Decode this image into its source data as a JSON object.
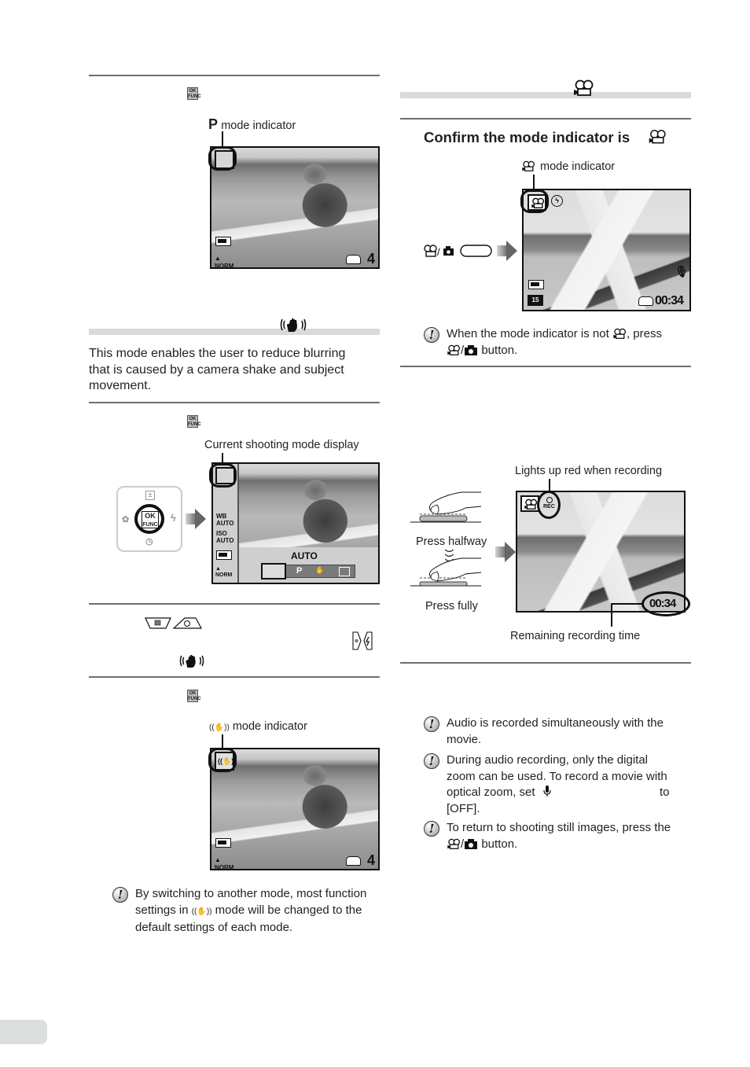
{
  "left_column": {
    "section_p": {
      "step_icon": "ok-func-button-icon",
      "callout_label": "mode indicator",
      "callout_prefix": "P",
      "lcd": {
        "image_subject": "girl reading on grass",
        "bottom_left_icons": [
          "battery-icon",
          "image-quality-norm-icon"
        ],
        "bottom_right_icon": "memory-icon",
        "shots_remaining": "4"
      }
    },
    "section_dis": {
      "header_icon": "digital-image-stabilization-icon",
      "description": [
        "This mode enables the user to reduce blurring",
        "that is caused by a camera shake and subject",
        "movement."
      ],
      "step1": {
        "step_icon": "ok-func-button-icon",
        "callout_label": "Current shooting mode display",
        "dpad": {
          "center_top": "OK",
          "center_bottom": "FUNC",
          "up_icon": "exposure-compensation-icon",
          "down_icon": "self-timer-icon",
          "left_icon": "macro-icon",
          "right_icon": "flash-icon"
        },
        "lcd": {
          "side_items": [
            "WB AUTO",
            "ISO AUTO",
            "battery-icon",
            "NORM"
          ],
          "wb_line1": "WB",
          "wb_line2": "AUTO",
          "iso_line1": "ISO",
          "iso_line2": "AUTO",
          "norm": "NORM",
          "selected_mode_label": "AUTO",
          "mode_options": [
            "AUTO",
            "P",
            "DIS",
            "SCENE"
          ],
          "mode_p": "P"
        }
      },
      "step2": {
        "buttons_icons": [
          "exposure-compensation-button-icon",
          "self-timer-button-icon"
        ],
        "side_buttons_icons": [
          "macro-button-icon",
          "flash-button-icon"
        ],
        "target_icon": "digital-image-stabilization-icon"
      },
      "step3": {
        "step_icon": "ok-func-button-icon",
        "callout_label": "mode indicator",
        "lcd": {
          "shots_remaining": "4"
        }
      },
      "note": {
        "line1": "By switching to another mode, most function",
        "line2a": "settings in",
        "line2b": "mode will be changed to the",
        "line3": "default settings of each mode."
      }
    }
  },
  "right_column": {
    "section_movie": {
      "header_icon": "movie-mode-icon",
      "step1": {
        "heading": "Confirm the mode indicator is",
        "callout_label": "mode indicator",
        "button_label_icons": [
          "movie-icon",
          "camera-icon"
        ],
        "button_sep": "/",
        "lcd": {
          "image_subject": "seagull in flight",
          "top_icons": [
            "movie-mode-icon",
            "flash-off-icon"
          ],
          "right_icon": "microphone-icon",
          "bottom_left_icons": [
            "battery-icon",
            "frame-rate-15-icon"
          ],
          "frame_rate": "15",
          "remaining_time": "00:34"
        },
        "note": {
          "line1a": "When the mode indicator is not",
          "line1b": ", press",
          "line2b": "button.",
          "sep": "/"
        }
      },
      "step2": {
        "callout_top": "Lights up red when recording",
        "press_halfway": "Press halfway",
        "press_fully": "Press fully",
        "rec_label": "REC",
        "remaining_time": "00:34",
        "callout_bottom": "Remaining recording time"
      },
      "notes": [
        {
          "lines": [
            "Audio is recorded simultaneously with the",
            "movie."
          ]
        },
        {
          "lines": [
            "During audio recording, only the digital",
            "zoom can be used. To record a movie with",
            "optical zoom, set",
            "to",
            "[OFF]."
          ]
        },
        {
          "lines": [
            "To return to shooting still images, press the",
            "button."
          ]
        }
      ],
      "note_sep": "/"
    }
  },
  "page_tab": {
    "label": ""
  }
}
